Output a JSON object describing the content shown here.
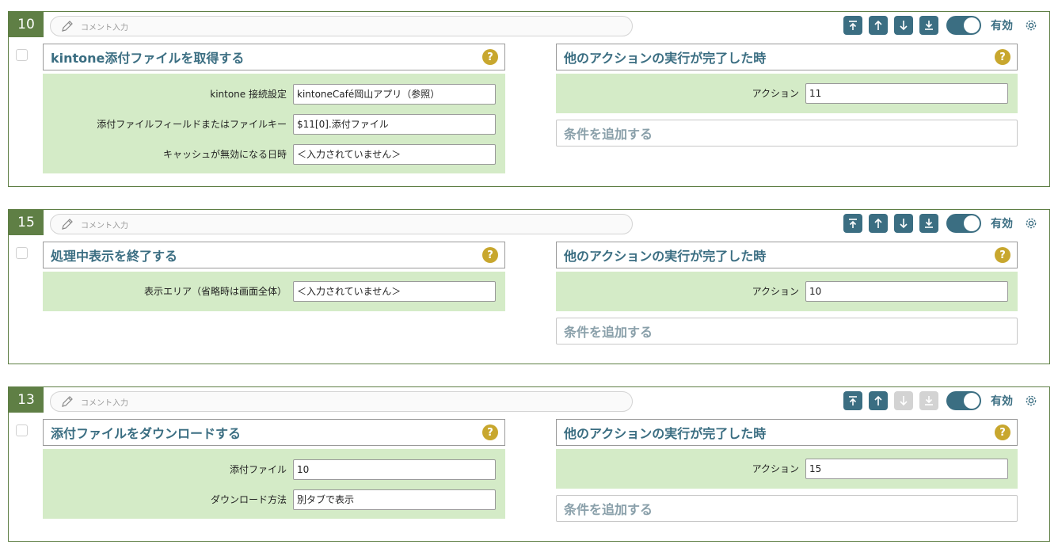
{
  "common": {
    "comment_placeholder": "コメント入力",
    "valid_label": "有効",
    "help_symbol": "?",
    "add_condition_label": "条件を追加する",
    "trigger_title": "他のアクションの実行が完了した時",
    "trigger_action_label": "アクション",
    "icons": [
      "pencil-icon",
      "move-top-icon",
      "move-up-icon",
      "move-down-icon",
      "move-bottom-icon",
      "gear-icon"
    ],
    "colors": {
      "frame": "#5f7f45",
      "accent": "#3b6e82",
      "help": "#c8a72e",
      "panel_bg": "#d4ebc7",
      "disabled": "#d3d3d3"
    }
  },
  "blocks": [
    {
      "number": "10",
      "title": "kintone添付ファイルを取得する",
      "enabled": true,
      "down_buttons_enabled": true,
      "fields": [
        {
          "label": "kintone 接続設定",
          "value": "kintoneCafé岡山アプリ（参照）"
        },
        {
          "label": "添付ファイルフィールドまたはファイルキー",
          "value": "$11[0].添付ファイル"
        },
        {
          "label": "キャッシュが無効になる日時",
          "value": "＜入力されていません＞"
        }
      ],
      "trigger_action_value": "11"
    },
    {
      "number": "15",
      "title": "処理中表示を終了する",
      "enabled": true,
      "down_buttons_enabled": true,
      "fields": [
        {
          "label": "表示エリア（省略時は画面全体）",
          "value": "＜入力されていません＞"
        }
      ],
      "trigger_action_value": "10"
    },
    {
      "number": "13",
      "title": "添付ファイルをダウンロードする",
      "enabled": true,
      "down_buttons_enabled": false,
      "fields": [
        {
          "label": "添付ファイル",
          "value": "10"
        },
        {
          "label": "ダウンロード方法",
          "value": "別タブで表示"
        }
      ],
      "trigger_action_value": "15"
    }
  ]
}
